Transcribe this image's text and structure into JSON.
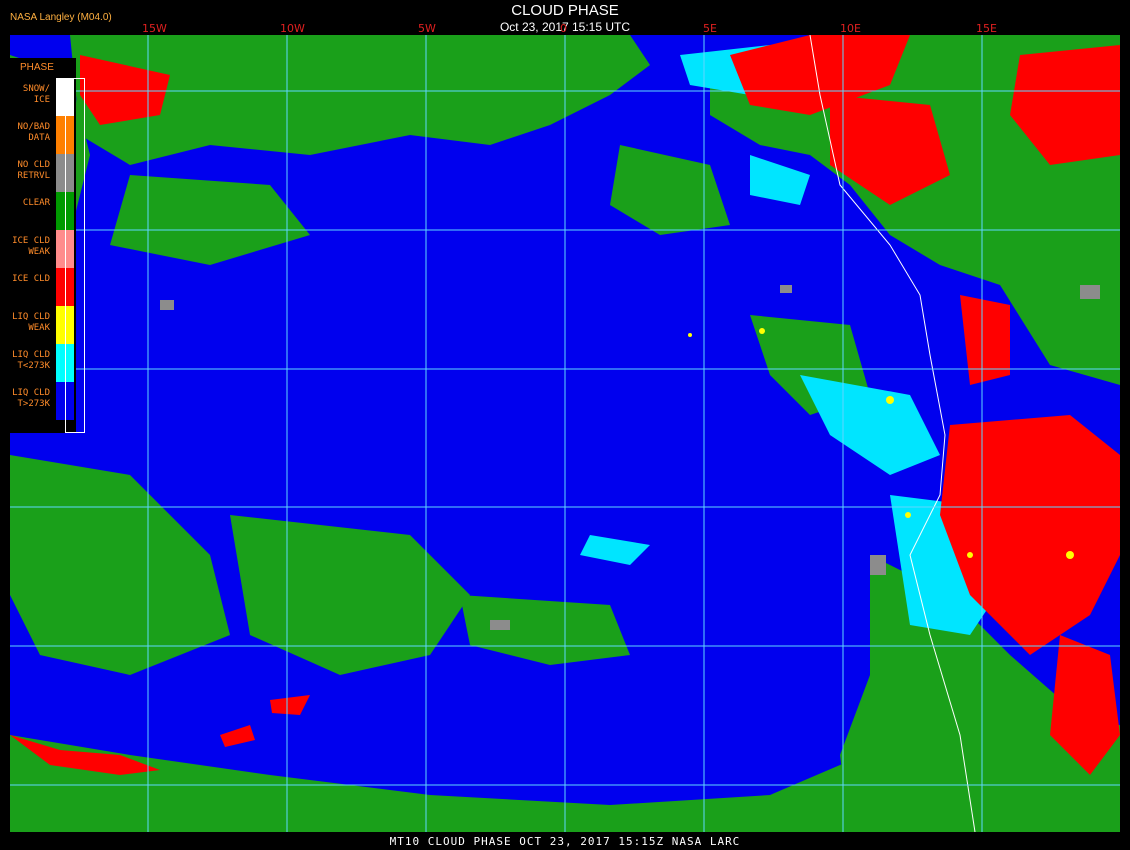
{
  "header": {
    "credit": "NASA Langley (M04.0)",
    "title": "CLOUD PHASE",
    "datetime": "Oct 23, 2017 15:15 UTC"
  },
  "longitude_labels": [
    "15W",
    "10W",
    "5W",
    "0",
    "5E",
    "10E",
    "15E"
  ],
  "legend": {
    "heading": "PHASE",
    "items": [
      {
        "label": "SNOW/\nICE",
        "color": "#ffffff"
      },
      {
        "label": "NO/BAD\nDATA",
        "color": "#ff8000"
      },
      {
        "label": "NO CLD\nRETRVL",
        "color": "#8c8c8c"
      },
      {
        "label": "CLEAR",
        "color": "#009a00"
      },
      {
        "label": "ICE CLD\nWEAK",
        "color": "#ff8c8c"
      },
      {
        "label": "ICE CLD",
        "color": "#ff0000"
      },
      {
        "label": "LIQ CLD\nWEAK",
        "color": "#ffff00"
      },
      {
        "label": "LIQ CLD\nT<273K",
        "color": "#00ffff"
      },
      {
        "label": "LIQ CLD\nT>273K",
        "color": "#0000ee"
      }
    ]
  },
  "colors": {
    "ocean_liquid": "#0000ee",
    "clear": "#1aa01a",
    "ice": "#ff0000",
    "liquid_cold": "#00e5ff",
    "grid": "#5fd7ff"
  },
  "footer": {
    "caption": "MT10  CLOUD PHASE  OCT 23, 2017 15:15Z  NASA LARC"
  }
}
